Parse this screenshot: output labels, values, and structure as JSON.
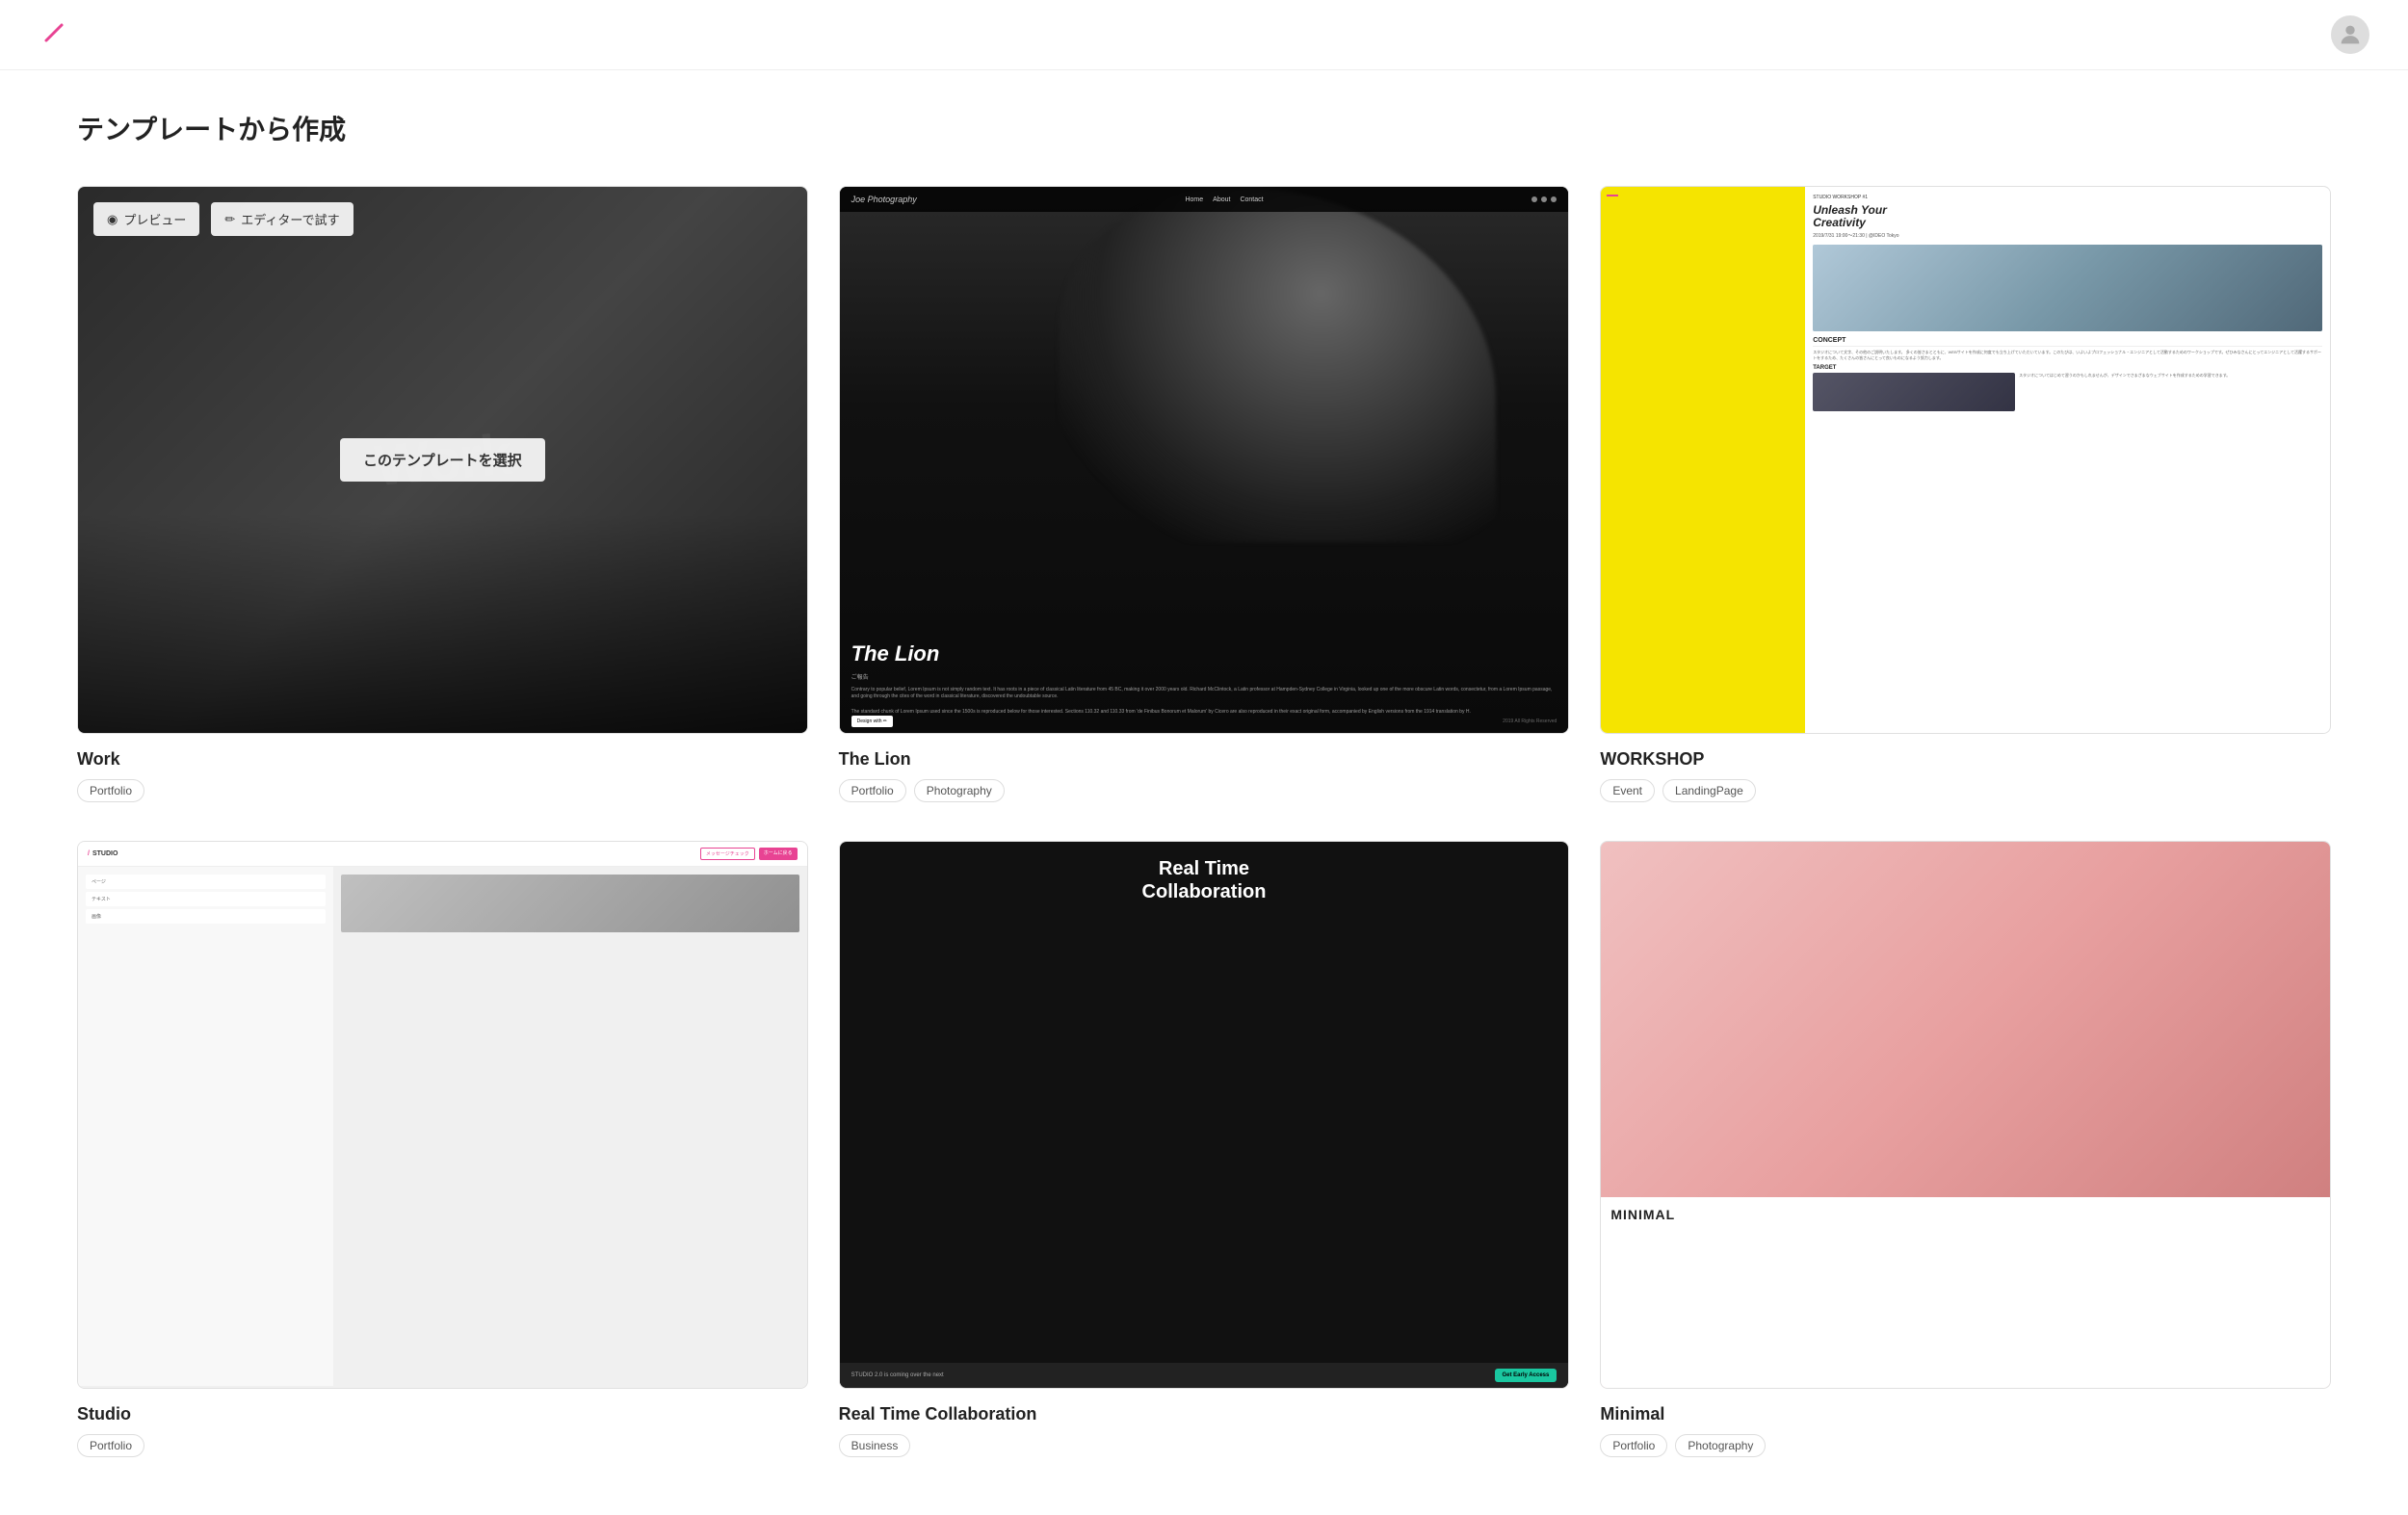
{
  "header": {
    "logo_alt": "Logo"
  },
  "page": {
    "title": "テンプレートから作成"
  },
  "templates": [
    {
      "id": "work",
      "name": "Work",
      "tags": [
        "Portfolio"
      ],
      "overlay": {
        "preview_label": "プレビュー",
        "editor_label": "エディターで試す",
        "select_label": "このテンプレートを選択"
      }
    },
    {
      "id": "lion",
      "name": "The Lion",
      "tags": [
        "Portfolio",
        "Photography"
      ],
      "nav_logo": "Joe Photography",
      "nav_links": [
        "Home",
        "About",
        "Contact"
      ],
      "hero_title": "The Lion",
      "subtitle": "ご報告",
      "body_text": "Contrary to popular belief, Lorem Ipsum is not simply random text. It has roots in a piece of classical Latin literature from 45 BC, making it over 2000 years old. Richard McClintock, a Latin professor at Hampden-Sydney College in Virginia, looked up one of the more obscure Latin words, consectetur, from a Lorem Ipsum passage, and going through the cites of the word in classical literature, discovered the undoubtable source.",
      "body_text2": "The standard chunk of Lorem Ipsum used since the 1500s is reproduced below for those interested. Sections 110.32 and 110.33 from 'de Finibus Bonorum et Malorum' by Cicero are also reproduced in their exact original form, accompanied by English versions from the 1914 translation by H.",
      "footer_btn": "Design with ✏",
      "footer_copy": "2019 All Rights Reserved"
    },
    {
      "id": "workshop",
      "name": "WORKSHOP",
      "tags": [
        "Event",
        "LandingPage"
      ],
      "workshop_label": "STUDIO WORKSHOP #1",
      "workshop_title": "Unleash Your\nCreativity",
      "workshop_date": "2019/7/31 19:00〜21:30 | @IDEO Tokyo",
      "concept_label": "CONCEPT",
      "concept_text": "スタジオについて文字、その他のご説明いたします。\n多くの皆さまとともに、WEBサイトを作成に何度でも立ち上げていただいています。このたびは、いよいよプロフェッショナル・エンジニアとして活動するためのワークショップです。ぜひみなさんにとってエンジニアとして活躍するサポートをするため、たくさんの皆さんにとって良いものになるよう努力します。",
      "target_label": "TARGET"
    },
    {
      "id": "studio",
      "name": "Studio",
      "tags": [
        "Portfolio"
      ],
      "logo_text": "STUDIO",
      "btn1": "メッセージチェック",
      "btn2": "ホームに戻る"
    },
    {
      "id": "realtime",
      "name": "Real Time Collaboration",
      "tags": [
        "Business"
      ],
      "hero_title": "Real Time\nCollaboration",
      "bottom_text": "STUDIO 2.0 is coming over the next",
      "cta_label": "Get Early Access"
    },
    {
      "id": "pink",
      "name": "Minimal",
      "tags": [
        "Portfolio",
        "Photography"
      ],
      "title_text": "MINIMAL"
    }
  ],
  "icons": {
    "eye": "◉",
    "pencil": "✏",
    "user": "👤"
  }
}
